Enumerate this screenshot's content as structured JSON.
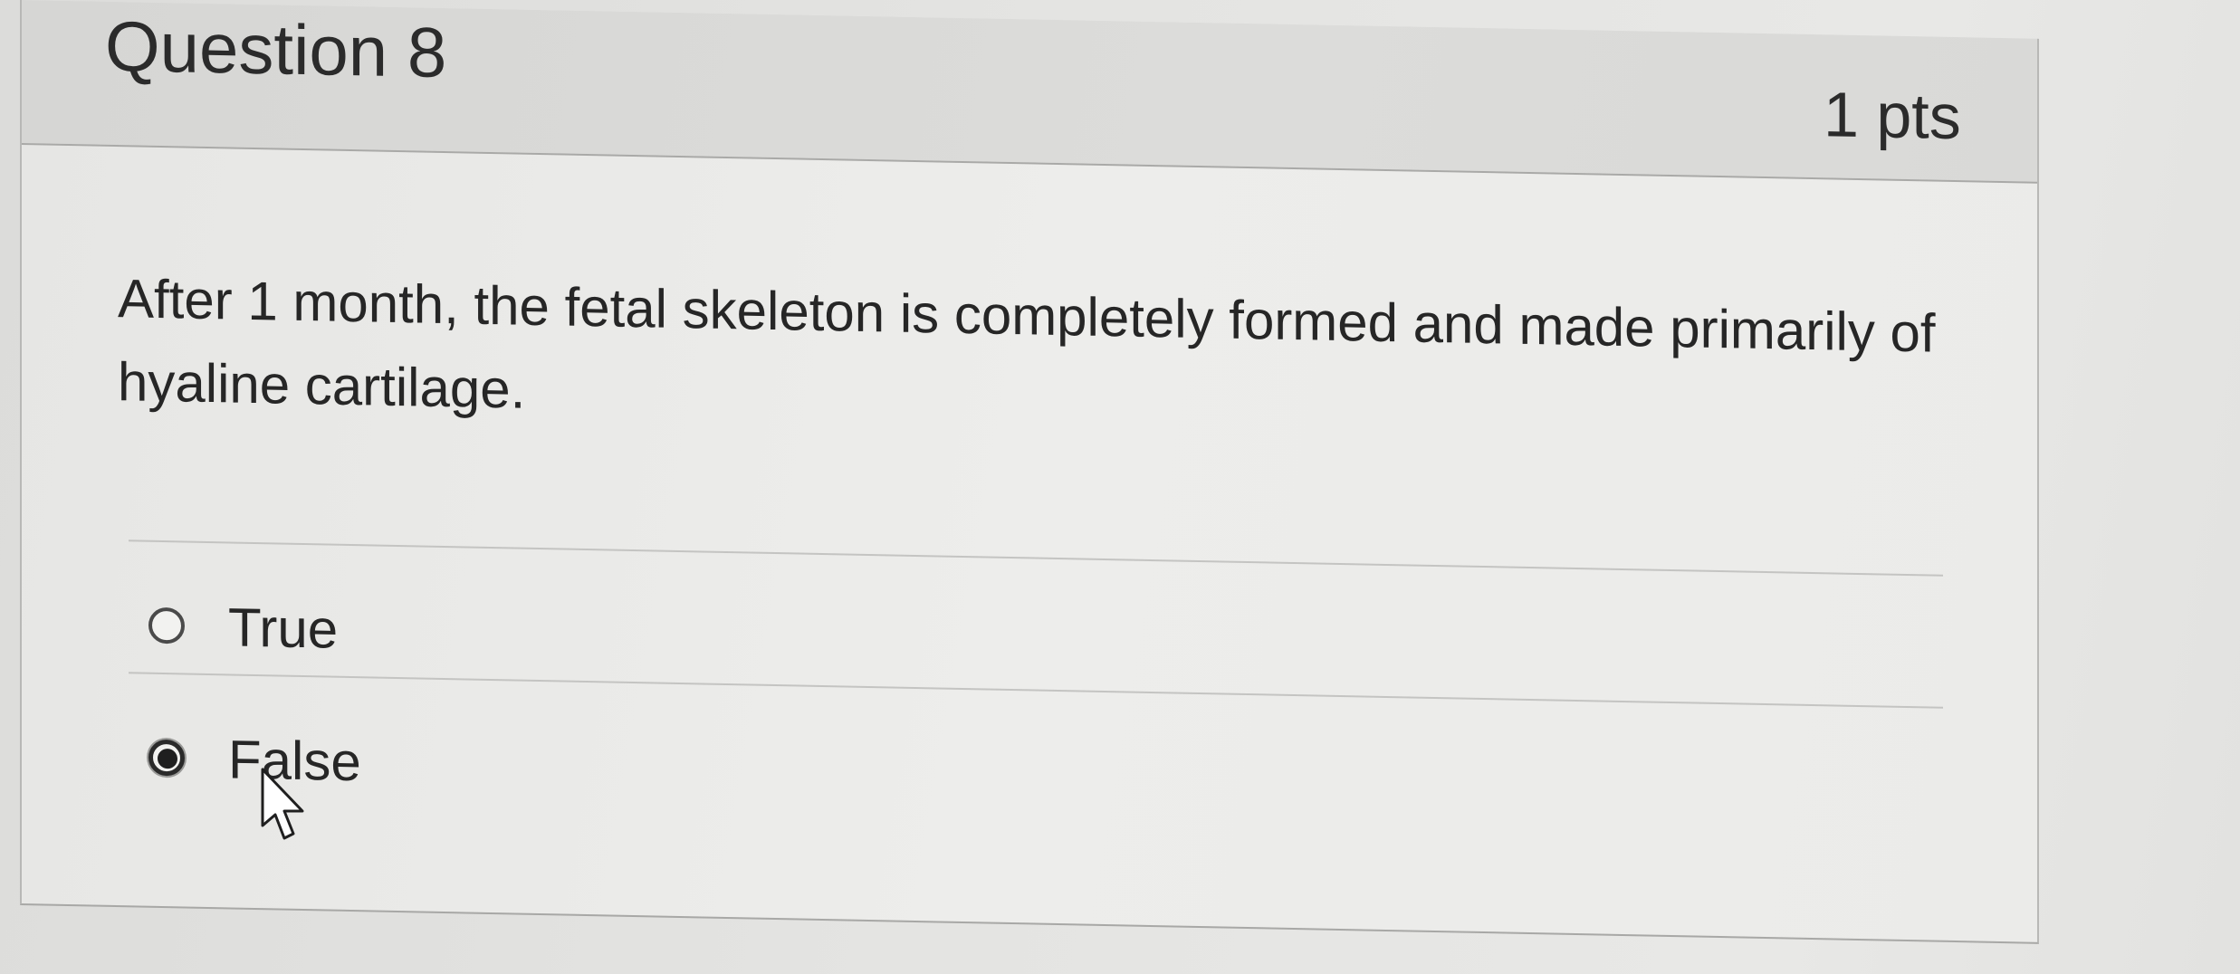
{
  "question": {
    "title": "Question 8",
    "points": "1 pts",
    "text": "After 1 month, the fetal skeleton is completely formed and made primarily of hyaline cartilage.",
    "answers": [
      {
        "label": "True",
        "selected": false
      },
      {
        "label": "False",
        "selected": true
      }
    ]
  },
  "icons": {
    "cursor": "mouse-pointer-icon"
  }
}
